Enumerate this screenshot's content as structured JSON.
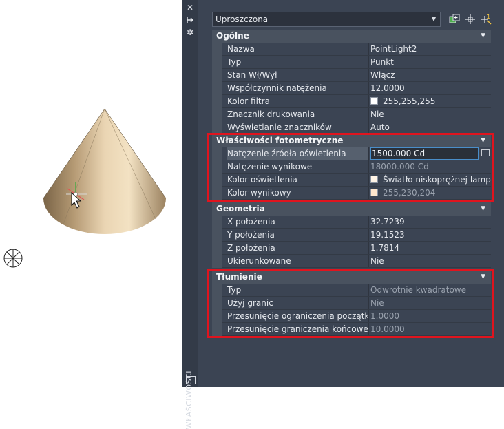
{
  "palette": {
    "title": "WŁAŚCIWOŚCI",
    "selector": "Uproszczona"
  },
  "sections": {
    "general": {
      "title": "Ogólne",
      "rows": [
        {
          "label": "Nazwa",
          "value": "PointLight2"
        },
        {
          "label": "Typ",
          "value": "Punkt"
        },
        {
          "label": "Stan Wł/Wył",
          "value": "Włącz"
        },
        {
          "label": "Współczynnik natężenia",
          "value": "12.0000"
        },
        {
          "label": "Kolor filtra",
          "value": "255,255,255"
        },
        {
          "label": "Znacznik drukowania",
          "value": "Nie"
        },
        {
          "label": "Wyświetlanie znaczników",
          "value": "Auto"
        }
      ]
    },
    "photometric": {
      "title": "Właściwości fotometryczne",
      "rows": [
        {
          "label": "Natężenie źródła oświetlenia",
          "value": "1500.000 Cd"
        },
        {
          "label": "Natężenie wynikowe",
          "value": "18000.000 Cd"
        },
        {
          "label": "Kolor oświetlenia",
          "value": "Światło niskoprężnej lampy..."
        },
        {
          "label": "Kolor wynikowy",
          "value": "255,230,204"
        }
      ]
    },
    "geometry": {
      "title": "Geometria",
      "rows": [
        {
          "label": "X położenia",
          "value": "32.7239"
        },
        {
          "label": "Y położenia",
          "value": "19.1523"
        },
        {
          "label": "Z położenia",
          "value": "1.7814"
        },
        {
          "label": "Ukierunkowane",
          "value": "Nie"
        }
      ]
    },
    "attenuation": {
      "title": "Tłumienie",
      "rows": [
        {
          "label": "Typ",
          "value": "Odwrotnie kwadratowe"
        },
        {
          "label": "Użyj granic",
          "value": "Nie"
        },
        {
          "label": "Przesunięcie ograniczenia początk...",
          "value": "1.0000"
        },
        {
          "label": "Przesunięcie graniczenia końcowego",
          "value": "10.0000"
        }
      ]
    }
  },
  "colors": {
    "highlight_box": "#e0141e",
    "filter_swatch": "#ffffff",
    "light_swatch": "#fff4e6",
    "result_swatch": "#ffe6cc"
  },
  "icons": [
    "close-icon",
    "pin-icon",
    "settings-icon",
    "quick-select-icon",
    "select-objects-icon",
    "toggle-pickadd-icon",
    "palette-menu-icon",
    "point-light-glyph"
  ]
}
